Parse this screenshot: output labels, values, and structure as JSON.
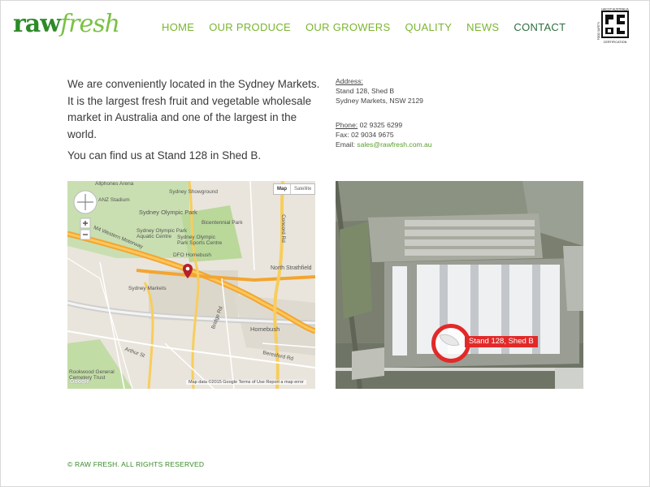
{
  "brand": {
    "logo_raw": "raw",
    "logo_fresh": "fresh"
  },
  "nav": {
    "items": [
      {
        "label": "HOME"
      },
      {
        "label": "OUR PRODUCE"
      },
      {
        "label": "OUR GROWERS"
      },
      {
        "label": "QUALITY"
      },
      {
        "label": "NEWS"
      },
      {
        "label": "CONTACT",
        "active": true
      }
    ]
  },
  "badge": {
    "top_text": "HACCP AUSTRALIA",
    "side_text": "FOOD SAFETY",
    "bottom_text": "CERTIFICATION"
  },
  "intro": {
    "paragraph1": "We are conveniently located in the Sydney Markets. It is the largest fresh fruit and vegetable wholesale market in Australia and one of the largest in the world.",
    "paragraph2": "You can find us at Stand 128 in Shed B."
  },
  "contact": {
    "address_label": "Address:",
    "address_line1": "Stand 128, Shed B",
    "address_line2": "Sydney Markets, NSW 2129",
    "phone_label": "Phone:",
    "phone": "02 9325 6299",
    "fax_label": "Fax:",
    "fax": "02 9034 9675",
    "email_label": "Email:",
    "email": "sales@rawfresh.com.au"
  },
  "street_map": {
    "toggle_map": "Map",
    "toggle_satellite": "Satellite",
    "labels": {
      "allphones": "Allphones Arena",
      "showground": "Sydney Showground",
      "anz": "ANZ Stadium",
      "olympic_park": "Sydney Olympic Park",
      "bicentennial": "Bicentennial Park",
      "aquatic": "Sydney Olympic Park Aquatic Centre",
      "sports": "Sydney Olympic Park Sports Centre",
      "dfo": "DFO Homebush",
      "markets": "Sydney Markets",
      "north_strathfield": "North Strathfield",
      "homebush": "Homebush",
      "rookwood": "Rookwood General Cemetery Trust",
      "m4": "M4 Western Motorway",
      "concord": "Concord Rd",
      "arthur": "Arthur St",
      "bridge": "Bridge Rd",
      "beresford": "Beresford Rd"
    },
    "footer": "Map data ©2015 Google   Terms of Use   Report a map error",
    "google": "Google"
  },
  "sat_map": {
    "stand_label": "Stand 128, Shed B"
  },
  "footer": {
    "copyright": "© RAW FRESH. ALL RIGHTS RESERVED"
  },
  "colors": {
    "brand_dark": "#2d8a28",
    "brand_light": "#7ac143",
    "nav": "#7ab52f",
    "nav_active": "#2d6e3e",
    "marker": "#e22929"
  }
}
